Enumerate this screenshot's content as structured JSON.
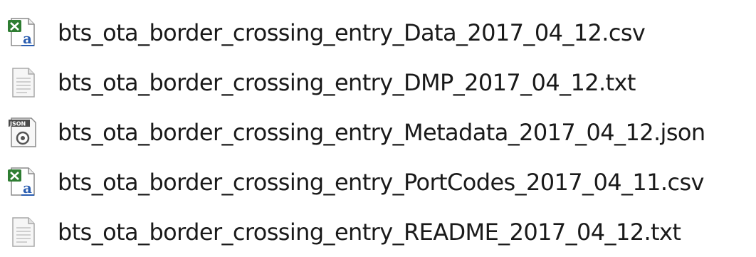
{
  "files": [
    {
      "name": "bts_ota_border_crossing_entry_Data_2017_04_12.csv",
      "icon": "excel-csv-icon"
    },
    {
      "name": "bts_ota_border_crossing_entry_DMP_2017_04_12.txt",
      "icon": "text-document-icon"
    },
    {
      "name": "bts_ota_border_crossing_entry_Metadata_2017_04_12.json",
      "icon": "json-file-icon"
    },
    {
      "name": "bts_ota_border_crossing_entry_PortCodes_2017_04_11.csv",
      "icon": "excel-csv-icon"
    },
    {
      "name": "bts_ota_border_crossing_entry_README_2017_04_12.txt",
      "icon": "text-document-icon"
    }
  ],
  "colors": {
    "excel_green": "#2e7d32",
    "excel_blue": "#2a5db0",
    "page_gray": "#c9c9c9"
  },
  "icon_text": {
    "json_label": "JSON"
  }
}
